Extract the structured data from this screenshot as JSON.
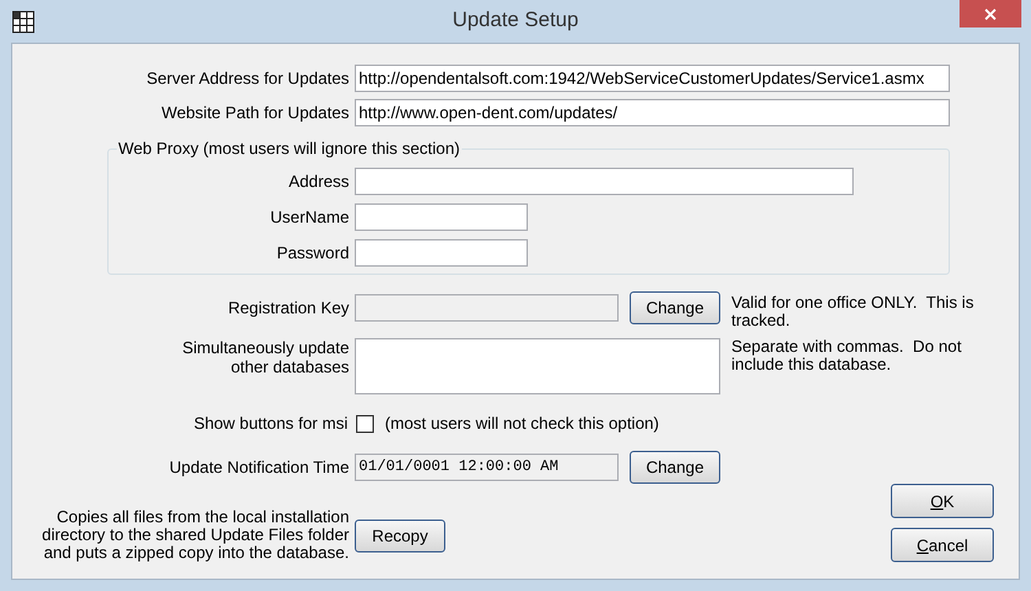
{
  "window": {
    "title": "Update Setup"
  },
  "server_address": {
    "label": "Server Address for Updates",
    "value": "http://opendentalsoft.com:1942/WebServiceCustomerUpdates/Service1.asmx"
  },
  "website_path": {
    "label": "Website Path for Updates",
    "value": "http://www.open-dent.com/updates/"
  },
  "web_proxy": {
    "title": "Web Proxy (most users will ignore this section)",
    "fields": [
      {
        "label": "Address",
        "kind": "wide"
      },
      {
        "label": "UserName",
        "kind": "short"
      },
      {
        "label": "Password",
        "kind": "short"
      }
    ]
  },
  "registration_key": {
    "label": "Registration Key",
    "button": "Change",
    "note": "Valid for one office ONLY.  This is tracked."
  },
  "other_databases": {
    "label": "Simultaneously update other databases",
    "note": "Separate with commas.  Do not include this database."
  },
  "show_msi": {
    "label": "Show buttons for msi",
    "checked": false,
    "note": "(most users will not check this option)"
  },
  "notification_time": {
    "label": "Update Notification Time",
    "value": "01/01/0001 12:00:00 AM",
    "button": "Change"
  },
  "recopy": {
    "label": "Copies all files from the local installation directory to the shared Update Files folder and puts a zipped copy into the database.",
    "button": "Recopy"
  },
  "buttons": [
    {
      "label": "OK",
      "first_letter_underlined": true
    },
    {
      "label": "Cancel",
      "first_letter_underlined": true
    }
  ]
}
